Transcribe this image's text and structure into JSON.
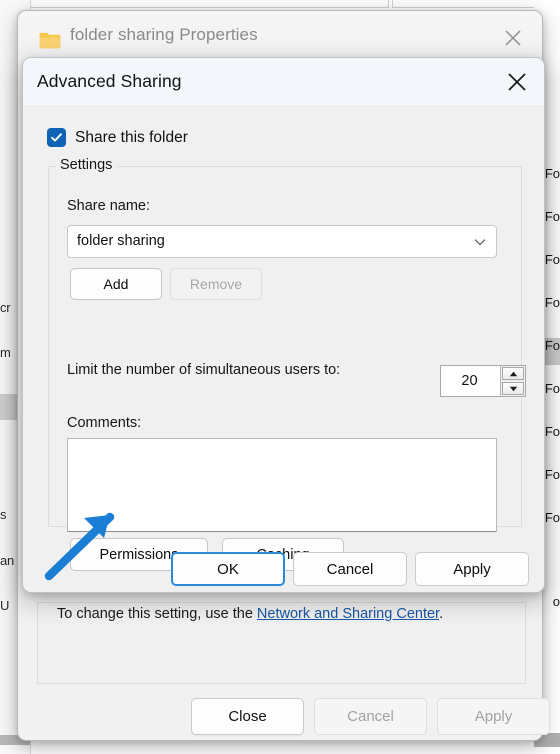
{
  "background_window": {
    "title": "folder sharing Properties",
    "folder_icon": "folder-icon",
    "close_icon": "close-icon",
    "info_text_before": "To change this setting, use the ",
    "info_link": "Network and Sharing Center",
    "info_text_after": ".",
    "buttons": {
      "close": "Close",
      "cancel": "Cancel",
      "apply": "Apply"
    }
  },
  "explorer_background": {
    "left_fragments": [
      "cr",
      "m",
      "s",
      "an",
      "U"
    ],
    "right_fragments": [
      "Fo",
      "Fo",
      "Fo",
      "Fo",
      "Fo",
      "Fo",
      "Fo",
      "Fo",
      "Fo",
      "o"
    ]
  },
  "dialog": {
    "title": "Advanced Sharing",
    "close_icon": "close-icon",
    "share_this_folder": {
      "label": "Share this folder",
      "checked": true,
      "check_icon": "check-icon"
    },
    "settings_group": {
      "legend": "Settings",
      "share_name_label": "Share name:",
      "share_name_value": "folder sharing",
      "share_name_chevron": "chevron-down-icon",
      "add_button": "Add",
      "remove_button": "Remove",
      "remove_enabled": false,
      "limit_label": "Limit the number of simultaneous users to:",
      "limit_value": "20",
      "spinner_up_icon": "caret-up-icon",
      "spinner_down_icon": "caret-down-icon",
      "comments_label": "Comments:",
      "comments_value": "",
      "permissions_button": "Permissions",
      "caching_button": "Caching"
    },
    "buttons": {
      "ok": "OK",
      "cancel": "Cancel",
      "apply": "Apply"
    }
  },
  "annotation": {
    "arrow_icon": "arrow-pointer-annotation",
    "color": "#1a7fd4",
    "points_to": "Permissions"
  },
  "colors": {
    "accent": "#0f63b5",
    "link": "#1757a6",
    "focus_border": "#2b8ad8",
    "dialog_bg": "#f0f0f0",
    "titlebar_bg": "#f3f6fb",
    "folder_icon": "#f5c84c"
  }
}
